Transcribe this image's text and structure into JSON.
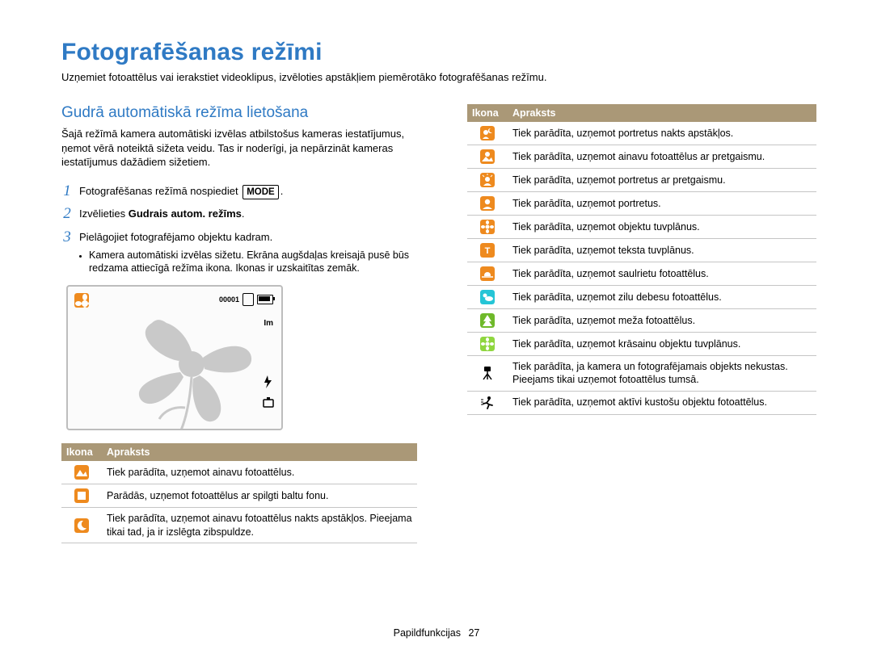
{
  "title": "Fotografēšanas režīmi",
  "intro": "Uzņemiet fotoattēlus vai ierakstiet videoklipus, izvēloties apstākļiem piemērotāko fotografēšanas režīmu.",
  "section": {
    "subtitle": "Gudrā automātiskā režīma lietošana",
    "desc": "Šajā režīmā kamera automātiski izvēlas atbilstošus kameras iestatījumus, ņemot vērā noteiktā sižeta veidu. Tas ir noderīgi, ja nepārzināt kameras iestatījumus dažādiem sižetiem.",
    "steps": {
      "s1_pre": "Fotografēšanas režīmā nospiediet",
      "s1_btn": "MODE",
      "s1_post": ".",
      "s2_pre": "Izvēlieties ",
      "s2_bold": "Gudrais autom. režīms",
      "s2_post": ".",
      "s3": "Pielāgojiet fotografējamo objektu kadram.",
      "s3_bullet": "Kamera automātiski izvēlas sižetu. Ekrāna augšdaļas kreisajā pusē būs redzama attiecīgā režīma ikona. Ikonas ir uzskaitītas zemāk."
    }
  },
  "screenshot": {
    "counter": "00001",
    "size_label": "Im"
  },
  "table_headers": {
    "icon": "Ikona",
    "desc": "Apraksts"
  },
  "left_rows": [
    {
      "id": "landscape",
      "desc": "Tiek parādīta, uzņemot ainavu fotoattēlus."
    },
    {
      "id": "white",
      "desc": "Parādās, uzņemot fotoattēlus ar spilgti baltu fonu."
    },
    {
      "id": "night-landscape",
      "desc": "Tiek parādīta, uzņemot ainavu fotoattēlus nakts apstākļos. Pieejama tikai tad, ja ir izslēgta zibspuldze."
    }
  ],
  "right_rows": [
    {
      "id": "night-portrait",
      "desc": "Tiek parādīta, uzņemot portretus nakts apstākļos."
    },
    {
      "id": "backlight-landscape",
      "desc": "Tiek parādīta, uzņemot ainavu fotoattēlus ar pretgaismu."
    },
    {
      "id": "backlight-portrait",
      "desc": "Tiek parādīta, uzņemot portretus ar pretgaismu."
    },
    {
      "id": "portrait",
      "desc": "Tiek parādīta, uzņemot portretus."
    },
    {
      "id": "macro",
      "desc": "Tiek parādīta, uzņemot objektu tuvplānus."
    },
    {
      "id": "macro-text",
      "desc": "Tiek parādīta, uzņemot teksta tuvplānus."
    },
    {
      "id": "sunset",
      "desc": "Tiek parādīta, uzņemot saulrietu fotoattēlus."
    },
    {
      "id": "blue-sky",
      "desc": "Tiek parādīta, uzņemot zilu debesu fotoattēlus."
    },
    {
      "id": "forest",
      "desc": "Tiek parādīta, uzņemot meža fotoattēlus."
    },
    {
      "id": "macro-color",
      "desc": "Tiek parādīta, uzņemot krāsainu objektu tuvplānus."
    },
    {
      "id": "tripod",
      "desc": "Tiek parādīta, ja kamera un fotografējamais objekts nekustas. Pieejams tikai uzņemot fotoattēlus tumsā."
    },
    {
      "id": "action",
      "desc": "Tiek parādīta, uzņemot aktīvi kustošu objektu fotoattēlus."
    }
  ],
  "footer": {
    "label": "Papildfunkcijas",
    "page": "27"
  }
}
